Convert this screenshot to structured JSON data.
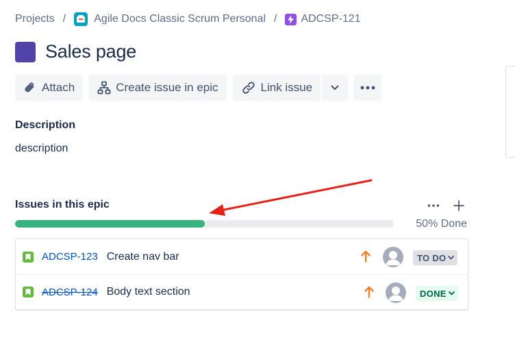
{
  "breadcrumb": {
    "projects": "Projects",
    "project": "Agile Docs Classic Scrum Personal",
    "epic_key": "ADCSP-121",
    "separator": "/"
  },
  "issue": {
    "title": "Sales page",
    "epic_color": "#5243AA"
  },
  "toolbar": {
    "attach_label": "Attach",
    "create_issue_label": "Create issue in epic",
    "link_issue_label": "Link issue"
  },
  "description": {
    "label": "Description",
    "text": "description"
  },
  "epic_issues": {
    "label": "Issues in this epic",
    "progress_percent": 50,
    "progress_text": "50% Done",
    "items": [
      {
        "key": "ADCSP-123",
        "summary": "Create nav bar",
        "priority": "high",
        "status": "TO DO",
        "done": false
      },
      {
        "key": "ADCSP-124",
        "summary": "Body text section",
        "priority": "high",
        "status": "DONE",
        "done": true
      }
    ]
  },
  "colors": {
    "progress_done": "#36B37E",
    "link": "#0052CC",
    "story": "#63BA3C",
    "priority_high": "#FF7452",
    "annotation_arrow": "#E62117"
  }
}
